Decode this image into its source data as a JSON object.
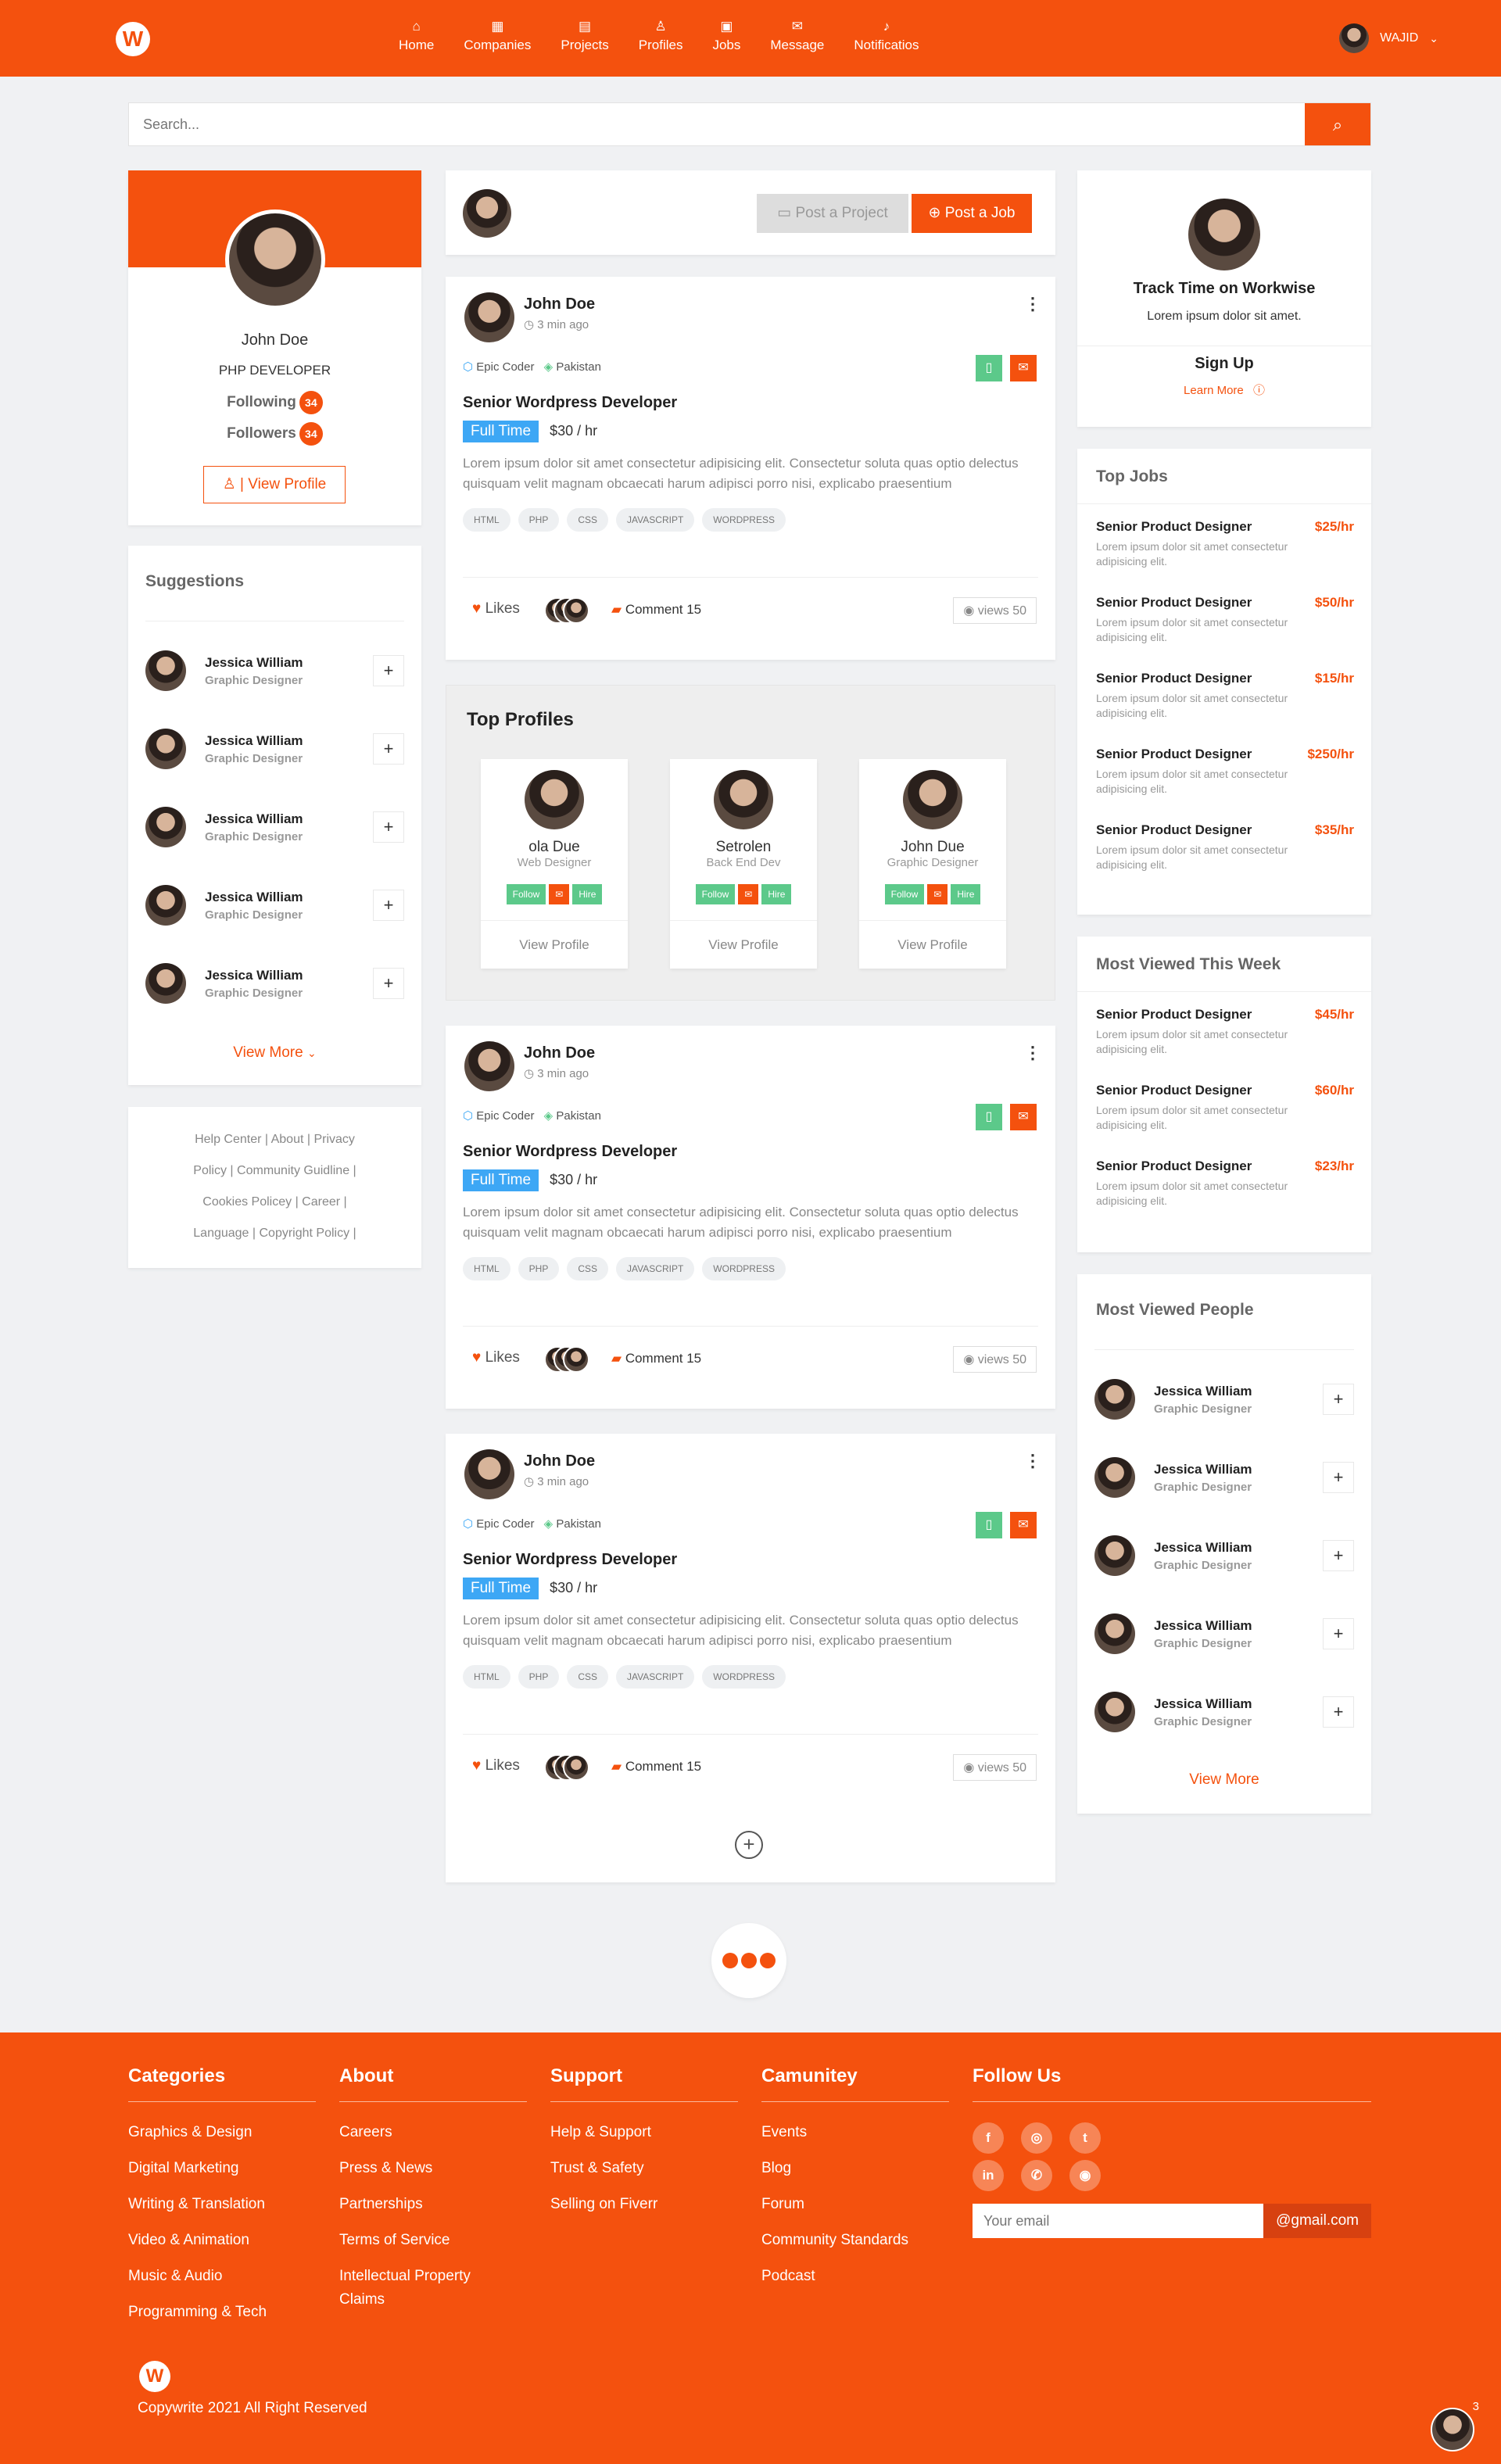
{
  "nav": {
    "items": [
      {
        "icon": "home-icon",
        "glyph": "⌂",
        "label": "Home"
      },
      {
        "icon": "building-icon",
        "glyph": "▦",
        "label": "Companies"
      },
      {
        "icon": "file-icon",
        "glyph": "▤",
        "label": "Projects"
      },
      {
        "icon": "user-icon",
        "glyph": "♙",
        "label": "Profiles"
      },
      {
        "icon": "briefcase-icon",
        "glyph": "▣",
        "label": "Jobs"
      },
      {
        "icon": "mail-icon",
        "glyph": "✉",
        "label": "Message"
      },
      {
        "icon": "bell-icon",
        "glyph": "♪",
        "label": "Notificatios"
      }
    ],
    "user": "WAJID"
  },
  "search": {
    "placeholder": "Search..."
  },
  "profile": {
    "name": "John Doe",
    "role": "PHP DEVELOPER",
    "following_label": "Following",
    "following": "34",
    "followers_label": "Followers",
    "followers": "34",
    "view_profile": "View Profile"
  },
  "suggestions": {
    "title": "Suggestions",
    "items": [
      {
        "name": "Jessica William",
        "role": "Graphic Designer"
      },
      {
        "name": "Jessica William",
        "role": "Graphic Designer"
      },
      {
        "name": "Jessica William",
        "role": "Graphic Designer"
      },
      {
        "name": "Jessica William",
        "role": "Graphic Designer"
      },
      {
        "name": "Jessica William",
        "role": "Graphic Designer"
      }
    ],
    "view_more": "View More"
  },
  "footer_links": {
    "l1": "Help Center",
    "l2": "About",
    "l3": "Privacy",
    "l4": "Policy",
    "l5": "Community Guidline",
    "l6": "Cookies Policey",
    "l7": "Career",
    "l8": "Language",
    "l9": "Copyright Policy"
  },
  "composer": {
    "post_project": "Post a Project",
    "post_job": "Post a Job"
  },
  "posts": [
    {
      "name": "John Doe",
      "time": "3 min ago",
      "company": "Epic Coder",
      "country": "Pakistan",
      "title": "Senior Wordpress Developer",
      "type": "Full Time",
      "rate": "$30 / hr",
      "desc": "Lorem ipsum dolor sit amet consectetur adipisicing elit. Consectetur soluta quas optio delectus quisquam velit magnam obcaecati harum adipisci porro nisi, explicabo praesentium",
      "tags": [
        "HTML",
        "PHP",
        "CSS",
        "JAVASCRIPT",
        "WORDPRESS"
      ],
      "likes": "Likes",
      "comment": "Comment 15",
      "views": "views 50"
    },
    {
      "name": "John Doe",
      "time": "3 min ago",
      "company": "Epic Coder",
      "country": "Pakistan",
      "title": "Senior Wordpress Developer",
      "type": "Full Time",
      "rate": "$30 / hr",
      "desc": "Lorem ipsum dolor sit amet consectetur adipisicing elit. Consectetur soluta quas optio delectus quisquam velit magnam obcaecati harum adipisci porro nisi, explicabo praesentium",
      "tags": [
        "HTML",
        "PHP",
        "CSS",
        "JAVASCRIPT",
        "WORDPRESS"
      ],
      "likes": "Likes",
      "comment": "Comment 15",
      "views": "views 50"
    },
    {
      "name": "John Doe",
      "time": "3 min ago",
      "company": "Epic Coder",
      "country": "Pakistan",
      "title": "Senior Wordpress Developer",
      "type": "Full Time",
      "rate": "$30 / hr",
      "desc": "Lorem ipsum dolor sit amet consectetur adipisicing elit. Consectetur soluta quas optio delectus quisquam velit magnam obcaecati harum adipisci porro nisi, explicabo praesentium",
      "tags": [
        "HTML",
        "PHP",
        "CSS",
        "JAVASCRIPT",
        "WORDPRESS"
      ],
      "likes": "Likes",
      "comment": "Comment 15",
      "views": "views 50"
    }
  ],
  "top_profiles": {
    "title": "Top Profiles",
    "follow": "Follow",
    "hire": "Hire",
    "view_profile": "View Profile",
    "items": [
      {
        "name": "ola Due",
        "role": "Web Designer"
      },
      {
        "name": "Setrolen",
        "role": "Back End Dev"
      },
      {
        "name": "John Due",
        "role": "Graphic Designer"
      }
    ]
  },
  "track": {
    "title": "Track Time on Workwise",
    "text": "Lorem ipsum dolor sit amet.",
    "signup": "Sign Up",
    "learn_more": "Learn More"
  },
  "top_jobs": {
    "title": "Top Jobs",
    "items": [
      {
        "title": "Senior Product Designer",
        "rate": "$25/hr",
        "desc": "Lorem ipsum dolor sit amet consectetur adipisicing elit."
      },
      {
        "title": "Senior Product Designer",
        "rate": "$50/hr",
        "desc": "Lorem ipsum dolor sit amet consectetur adipisicing elit."
      },
      {
        "title": "Senior Product Designer",
        "rate": "$15/hr",
        "desc": "Lorem ipsum dolor sit amet consectetur adipisicing elit."
      },
      {
        "title": "Senior Product Designer",
        "rate": "$250/hr",
        "desc": "Lorem ipsum dolor sit amet consectetur adipisicing elit."
      },
      {
        "title": "Senior Product Designer",
        "rate": "$35/hr",
        "desc": "Lorem ipsum dolor sit amet consectetur adipisicing elit."
      }
    ]
  },
  "most_viewed": {
    "title": "Most Viewed This Week",
    "items": [
      {
        "title": "Senior Product Designer",
        "rate": "$45/hr",
        "desc": "Lorem ipsum dolor sit amet consectetur adipisicing elit."
      },
      {
        "title": "Senior Product Designer",
        "rate": "$60/hr",
        "desc": "Lorem ipsum dolor sit amet consectetur adipisicing elit."
      },
      {
        "title": "Senior Product Designer",
        "rate": "$23/hr",
        "desc": "Lorem ipsum dolor sit amet consectetur adipisicing elit."
      }
    ]
  },
  "most_people": {
    "title": "Most Viewed People",
    "items": [
      {
        "name": "Jessica William",
        "role": "Graphic Designer"
      },
      {
        "name": "Jessica William",
        "role": "Graphic Designer"
      },
      {
        "name": "Jessica William",
        "role": "Graphic Designer"
      },
      {
        "name": "Jessica William",
        "role": "Graphic Designer"
      },
      {
        "name": "Jessica William",
        "role": "Graphic Designer"
      }
    ],
    "view_more": "View More"
  },
  "footer": {
    "categories": {
      "title": "Categories",
      "links": [
        "Graphics & Design",
        "Digital Marketing",
        "Writing & Translation",
        "Video & Animation",
        "Music & Audio",
        "Programming & Tech"
      ]
    },
    "about": {
      "title": "About",
      "links": [
        "Careers",
        "Press & News",
        "Partnerships",
        "Terms of Service",
        "Intellectual Property Claims"
      ]
    },
    "support": {
      "title": "Support",
      "links": [
        "Help & Support",
        "Trust & Safety",
        "Selling on Fiverr"
      ]
    },
    "community": {
      "title": "Camunitey",
      "links": [
        "Events",
        "Blog",
        "Forum",
        "Community Standards",
        "Podcast"
      ]
    },
    "follow": {
      "title": "Follow Us",
      "email_placeholder": "Your email",
      "email_suffix": "@gmail.com"
    },
    "copyright": "Copywrite 2021 All Right Reserved",
    "chat_count": "3"
  },
  "colors": {
    "brand": "#f4510e",
    "green": "#5cc98a",
    "blue": "#3da7f5"
  }
}
